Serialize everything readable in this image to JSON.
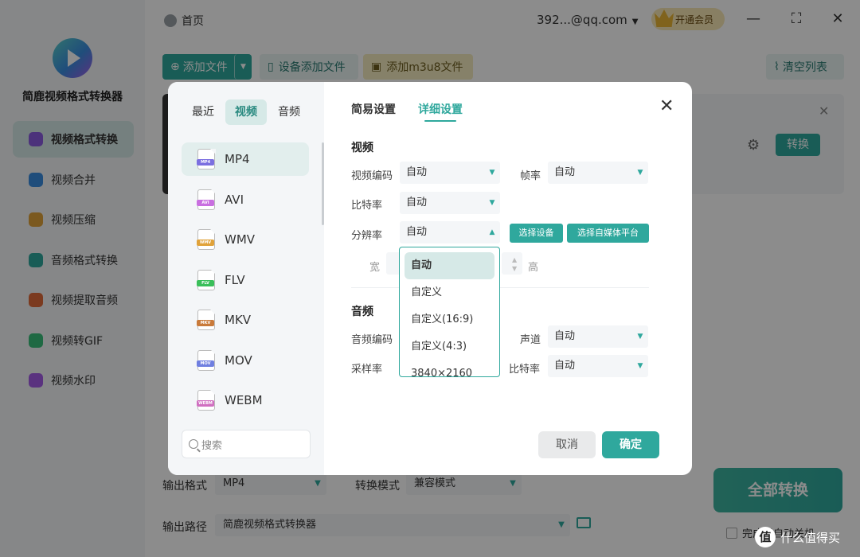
{
  "app": {
    "name": "简鹿视频格式转换器",
    "home": "首页",
    "account": "392...@qq.com",
    "vip_label": "开通会员",
    "sidebar": [
      {
        "label": "视频格式转换",
        "active": true,
        "color": "#8a5be0"
      },
      {
        "label": "视频合并",
        "color": "#3a8de0"
      },
      {
        "label": "视频压缩",
        "color": "#e0a23a"
      },
      {
        "label": "音频格式转换",
        "color": "#2fa89d"
      },
      {
        "label": "视频提取音频",
        "color": "#e06a3a"
      },
      {
        "label": "视频转GIF",
        "color": "#3abf7a"
      },
      {
        "label": "视频水印",
        "color": "#a45ce8"
      }
    ],
    "toolbar": {
      "add_file": "添加文件",
      "device_add": "设备添加文件",
      "add_m3u8": "添加m3u8文件",
      "clear_list": "清空列表"
    },
    "file_row": {
      "convert": "转换"
    },
    "footer": {
      "output_format_label": "输出格式",
      "output_format_value": "MP4",
      "convert_mode_label": "转换模式",
      "convert_mode_value": "兼容模式",
      "output_path_label": "输出路径",
      "output_path_value": "简鹿视频格式转换器",
      "convert_all": "全部转换",
      "auto_shutdown": "完成后自动关机"
    },
    "watermark": "什么值得买",
    "watermark_logo": "值"
  },
  "dialog": {
    "category_tabs": [
      {
        "label": "最近"
      },
      {
        "label": "视频",
        "active": true
      },
      {
        "label": "音频"
      }
    ],
    "formats": [
      {
        "label": "MP4",
        "color": "#7b6fe0",
        "active": true
      },
      {
        "label": "AVI",
        "color": "#c96fe0"
      },
      {
        "label": "WMV",
        "color": "#e0a23a"
      },
      {
        "label": "FLV",
        "color": "#3abf5a"
      },
      {
        "label": "MKV",
        "color": "#c97a3a"
      },
      {
        "label": "MOV",
        "color": "#6f7fe0"
      },
      {
        "label": "WEBM",
        "color": "#d06fc0"
      }
    ],
    "search_placeholder": "搜索",
    "settings_tabs": [
      {
        "label": "简易设置"
      },
      {
        "label": "详细设置",
        "active": true
      }
    ],
    "video": {
      "title": "视频",
      "codec_label": "视频编码",
      "codec_value": "自动",
      "framerate_label": "帧率",
      "framerate_value": "自动",
      "bitrate_label": "比特率",
      "bitrate_value": "自动",
      "resolution_label": "分辨率",
      "resolution_value": "自动",
      "select_device": "选择设备",
      "select_platform": "选择自媒体平台",
      "width_label": "宽",
      "height_label": "高"
    },
    "audio": {
      "title": "音频",
      "codec_label": "音频编码",
      "channel_label": "声道",
      "channel_value": "自动",
      "samplerate_label": "采样率",
      "bitrate_label": "比特率",
      "bitrate_value": "自动"
    },
    "resolution_options": [
      "自动",
      "自定义",
      "自定义(16:9)",
      "自定义(4:3)",
      "3840×2160"
    ],
    "cancel": "取消",
    "confirm": "确定"
  },
  "colors": {
    "accent": "#2fa89d",
    "active_bg": "#d6e9e7"
  }
}
